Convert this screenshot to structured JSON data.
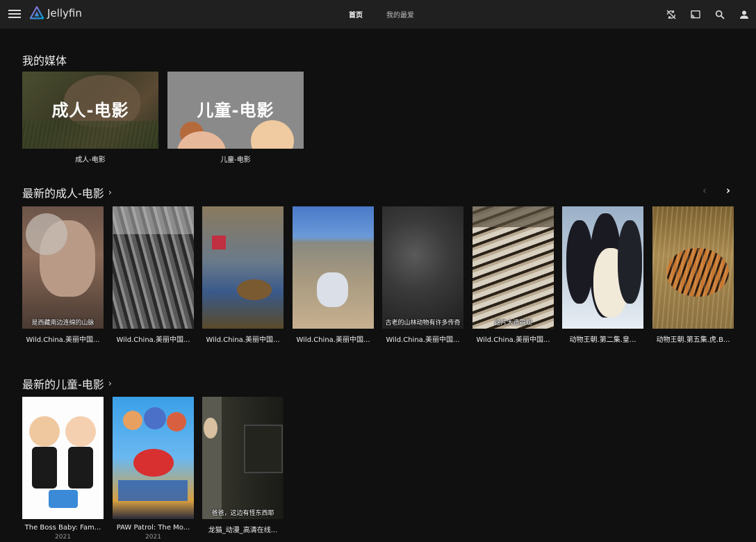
{
  "header": {
    "brand": "Jellyfin",
    "tabs": [
      {
        "label": "首页",
        "active": true
      },
      {
        "label": "我的最爱",
        "active": false
      }
    ],
    "icons": [
      "sync-play-icon",
      "cast-icon",
      "search-icon",
      "user-icon"
    ]
  },
  "sections": {
    "my_media": {
      "title": "我的媒体",
      "items": [
        {
          "overlay": "成人-电影",
          "caption": "成人-电影"
        },
        {
          "overlay": "儿童-电影",
          "caption": "儿童-电影"
        }
      ]
    },
    "latest_adult": {
      "title": "最新的成人-电影",
      "items": [
        {
          "caption": "Wild.China.美丽中国...",
          "subtitle": "是西藏南边连绵的山脉"
        },
        {
          "caption": "Wild.China.美丽中国...",
          "subtitle": ""
        },
        {
          "caption": "Wild.China.美丽中国...",
          "subtitle": ""
        },
        {
          "caption": "Wild.China.美丽中国...",
          "subtitle": ""
        },
        {
          "caption": "Wild.China.美丽中国...",
          "subtitle": "古老的山林动物有许多传奇"
        },
        {
          "caption": "Wild.China.美丽中国...",
          "subtitle": "这片大造景观"
        },
        {
          "caption": "动物王朝.第二集.皇...",
          "subtitle": ""
        },
        {
          "caption": "动物王朝.第五集.虎.B...",
          "subtitle": ""
        }
      ]
    },
    "latest_kids": {
      "title": "最新的儿童-电影",
      "items": [
        {
          "caption": "The Boss Baby: Fam...",
          "year": "2021",
          "subtitle": ""
        },
        {
          "caption": "PAW Patrol: The Mo...",
          "year": "2021",
          "subtitle": ""
        },
        {
          "caption": "龙猫_动漫_高清在线...",
          "year": "",
          "subtitle": "爸爸，这边有怪东西耶"
        }
      ]
    }
  },
  "colors": {
    "header_bg": "#202020",
    "page_bg": "#101010",
    "accent": "#00a4dc"
  }
}
